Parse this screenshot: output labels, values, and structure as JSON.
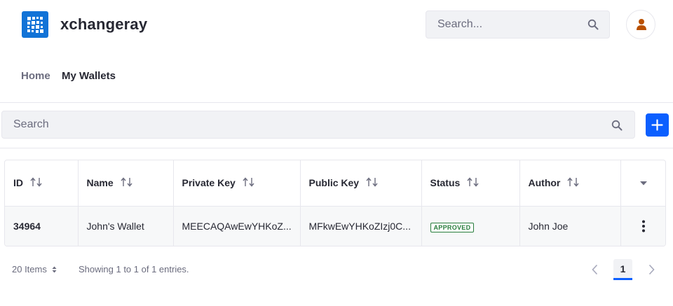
{
  "header": {
    "site_name": "xchangeray",
    "search_placeholder": "Search...",
    "logo_icon": "liferay-logo-icon",
    "avatar_icon": "user-icon"
  },
  "nav": {
    "items": [
      {
        "label": "Home"
      },
      {
        "label": "My Wallets"
      }
    ]
  },
  "toolbar": {
    "search_placeholder": "Search",
    "add_icon": "plus-icon"
  },
  "table": {
    "columns": [
      {
        "label": "ID"
      },
      {
        "label": "Name"
      },
      {
        "label": "Private Key"
      },
      {
        "label": "Public Key"
      },
      {
        "label": "Status"
      },
      {
        "label": "Author"
      }
    ],
    "rows": [
      {
        "id": "34964",
        "name": "John's Wallet",
        "private_key": "MEECAQAwEwYHKoZ...",
        "public_key": "MFkwEwYHKoZIzj0C...",
        "status": "APPROVED",
        "author": "John Joe"
      }
    ]
  },
  "pagination": {
    "items_label": "20 Items",
    "showing_text": "Showing 1 to 1 of 1 entries.",
    "current_page": "1"
  },
  "colors": {
    "primary": "#0b5fff",
    "logo": "#1273d7",
    "approved": "#287d3c",
    "avatar": "#b95000"
  }
}
